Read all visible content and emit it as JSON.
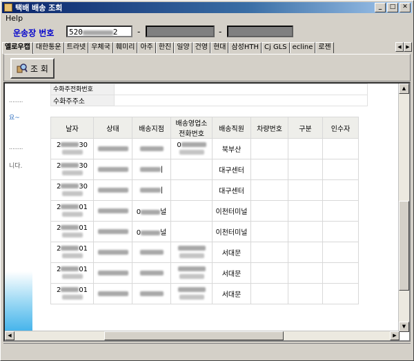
{
  "window": {
    "title": "택배 배송 조회",
    "controls": {
      "minimize": "_",
      "maximize": "□",
      "close": "✕"
    }
  },
  "menu": {
    "help": "Help"
  },
  "search": {
    "label": "운송장 번호",
    "waybill_prefix": "520",
    "waybill_suffix": "2",
    "dash": "-"
  },
  "tabs": [
    "옐로우캡",
    "대한통운",
    "트라넷",
    "우체국",
    "훼미리",
    "아주",
    "한진",
    "일양",
    "건영",
    "현대",
    "삼성HTH",
    "Cj GLS",
    "ecline",
    "로젠"
  ],
  "toolbar": {
    "query_label": "조 회"
  },
  "receiver": {
    "phone_label": "수화주전화번호",
    "address_label": "수화주주소"
  },
  "left_panel": {
    "dots1": "........",
    "text1": "요~",
    "dots2": "........",
    "text2": "니다."
  },
  "table": {
    "columns": [
      "날자",
      "상태",
      "배송지점",
      "배송영업소 전화번호",
      "배송직원",
      "차량번호",
      "구분",
      "인수자"
    ],
    "rows": [
      {
        "date_start": "2",
        "date_end": "30",
        "status": "",
        "branch_end": "",
        "phone_start": "0",
        "staff": "북부산",
        "date_partial": "2",
        "phone_partial": "0"
      },
      {
        "date_start": "2",
        "date_end": "30",
        "status": "",
        "branch_end": "|",
        "staff": "대구센터"
      },
      {
        "date_start": "2",
        "date_end": "30",
        "status": "",
        "branch_end": "|",
        "staff": "대구센터"
      },
      {
        "date_start": "2",
        "date_end": "01",
        "status": "",
        "branch_start": "0",
        "branch_end": "널",
        "staff": "이천터미널"
      },
      {
        "date_start": "2",
        "date_end": "01",
        "status": "",
        "branch_start": "0",
        "branch_end": "널",
        "staff": "이천터미널"
      },
      {
        "date_start": "2",
        "date_end": "01",
        "status": "",
        "staff": "서대문"
      },
      {
        "date_start": "2",
        "date_end": "01",
        "status": "",
        "staff": "서대문"
      },
      {
        "date_start": "2",
        "date_end": "01",
        "status": "",
        "staff": "서대문"
      }
    ]
  },
  "scroll": {
    "up": "▲",
    "down": "▼",
    "left": "◀",
    "right": "▶"
  }
}
